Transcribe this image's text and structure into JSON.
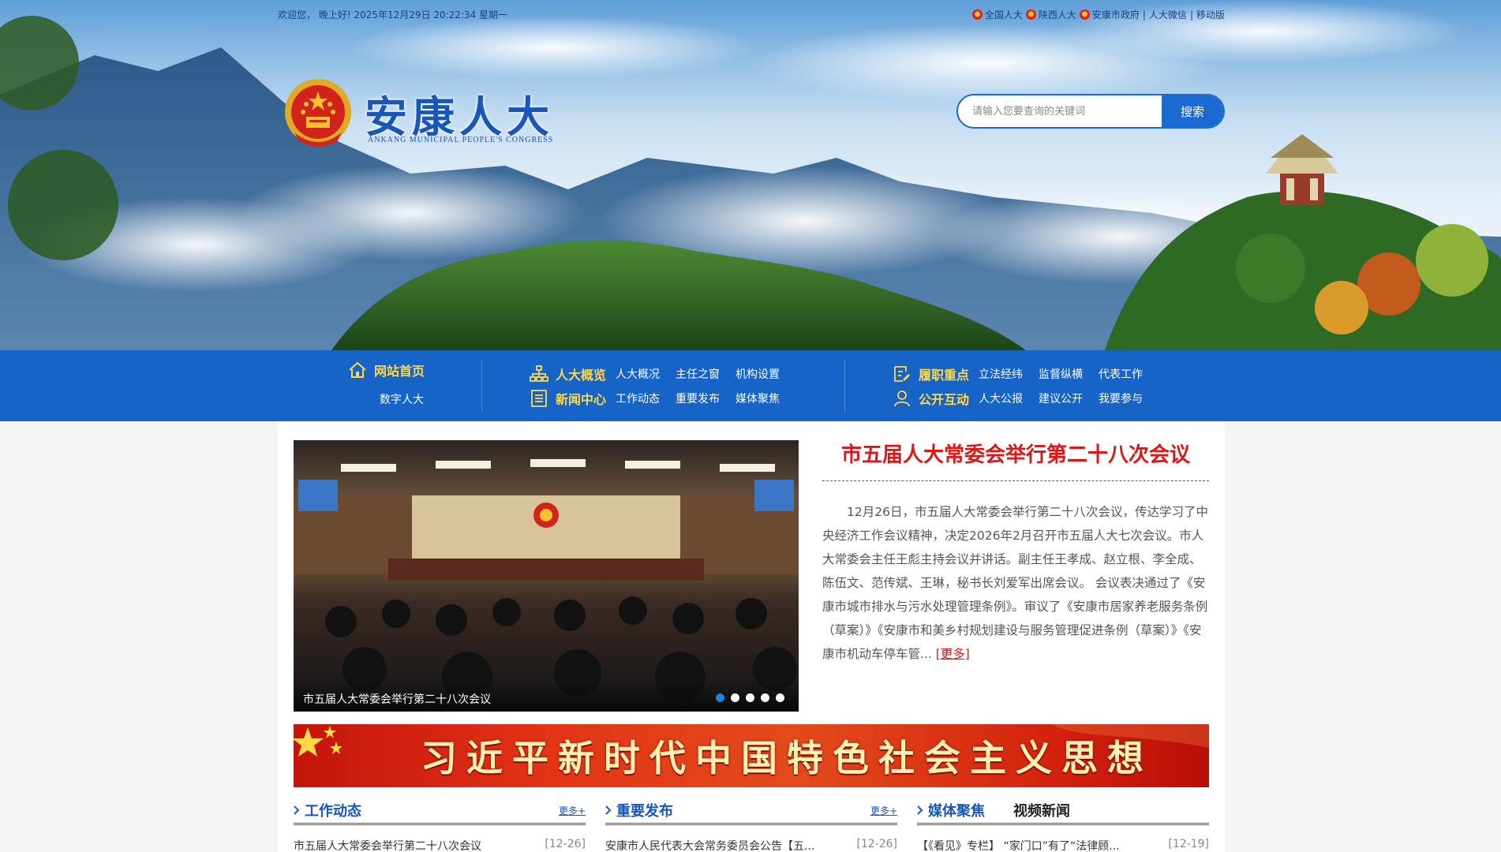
{
  "topbar": {
    "greeting": "欢迎您，  晚上好! 2025年12月29日 20:22:34 星期一",
    "links": [
      "全国人大",
      "陕西人大",
      "安康市政府"
    ],
    "text_links": [
      "人大微信",
      "移动版"
    ]
  },
  "logo": {
    "title": "安康人大",
    "subtitle": "ANKANG MUNICIPAL PEOPLE'S CONGRESS"
  },
  "search": {
    "placeholder": "请输入您要查询的关键词",
    "button_label": "搜索"
  },
  "nav": {
    "home": "网站首页",
    "digital": "数字人大",
    "overview": {
      "head": "人大概览",
      "items": [
        "人大概况",
        "主任之窗",
        "机构设置"
      ]
    },
    "news": {
      "head": "新闻中心",
      "items": [
        "工作动态",
        "重要发布",
        "媒体聚焦"
      ]
    },
    "duty": {
      "head": "履职重点",
      "items": [
        "立法经纬",
        "监督纵横",
        "代表工作"
      ]
    },
    "public": {
      "head": "公开互动",
      "items": [
        "人大公报",
        "建议公开",
        "我要参与"
      ]
    }
  },
  "slide": {
    "caption": "市五届人大常委会举行第二十八次会议",
    "dots": 5,
    "active_dot": 1
  },
  "headline": "市五届人大常委会举行第二十八次会议",
  "summary": "12月26日，市五届人大常委会举行第二十八次会议，传达学习了中央经济工作会议精神，决定2026年2月召开市五届人大七次会议。市人大常委会主任王彪主持会议并讲话。副主任王孝成、赵立根、李全成、陈伍文、范传斌、王琳，秘书长刘爱军出席会议。 会议表决通过了《安康市城市排水与污水处理管理条例》。审议了《安康市居家养老服务条例（草案）》《安康市和美乡村规划建设与服务管理促进条例（草案）》《安康市机动车停车管...",
  "summary_more": "[更多]",
  "xi_banner": "习近平新时代中国特色社会主义思想",
  "columns": [
    {
      "title": "工作动态",
      "more": "更多+",
      "item": "市五届人大常委会举行第二十八次会议",
      "date": "[12-26]"
    },
    {
      "title": "重要发布",
      "more": "更多+",
      "item": "安康市人民代表大会常务委员会公告【五...",
      "date": "[12-26]"
    },
    {
      "title": "媒体聚焦",
      "title_alt": "视频新闻",
      "item": "【《看见》专栏】 “家门口”有了“法律顾...",
      "date": "[12-19]"
    }
  ],
  "colors": {
    "nav_bg": "#1664c8",
    "nav_head": "#ffd84a",
    "headline_red": "#d61a1a",
    "brand_blue": "#1a56b8"
  }
}
